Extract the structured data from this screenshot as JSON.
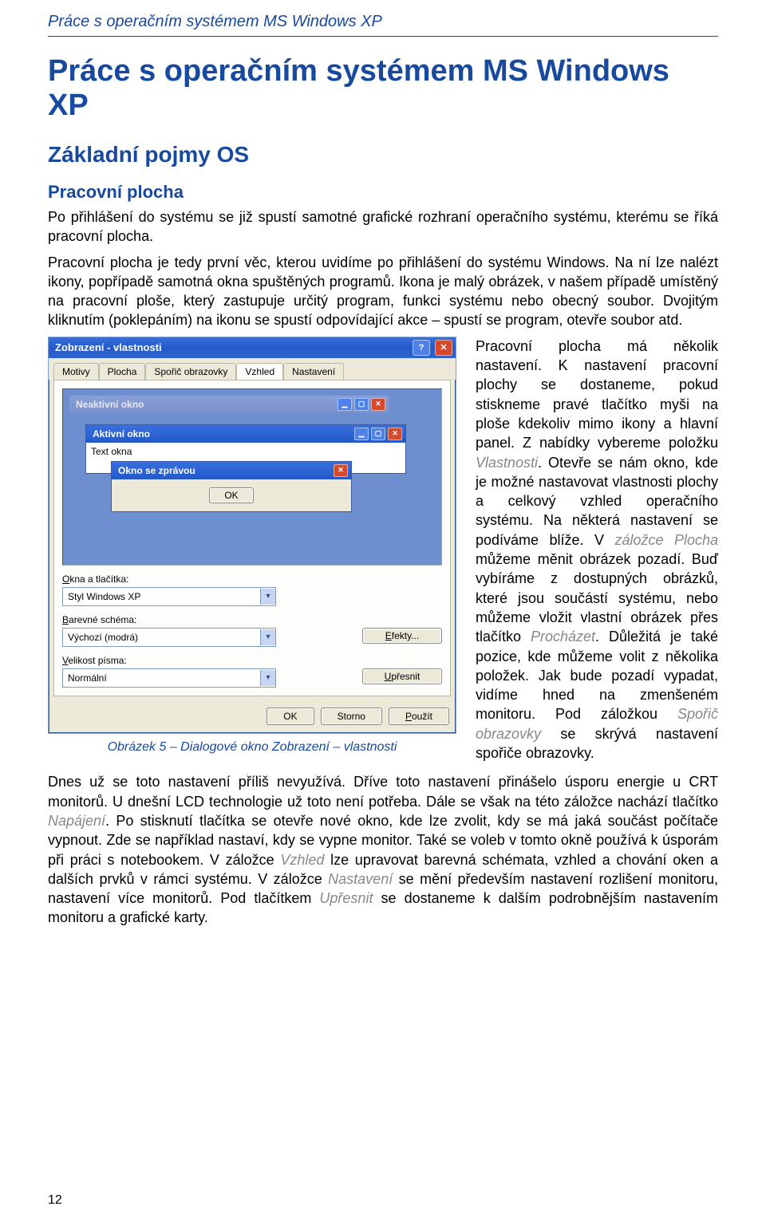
{
  "runningHead": "Práce s operačním systémem MS Windows XP",
  "headings": {
    "h1": "Práce s operačním systémem MS Windows XP",
    "h2": "Základní pojmy OS",
    "h3": "Pracovní plocha"
  },
  "paragraphs": {
    "p1": "Po přihlášení do systému se již spustí samotné grafické rozhraní operačního systému, kterému se říká pracovní plocha.",
    "p2": "Pracovní plocha je tedy první věc, kterou uvidíme po přihlášení do systému Windows. Na ní lze nalézt ikony, popřípadě samotná okna spuštěných programů. Ikona je malý obrázek, v našem případě umístěný na pracovní ploše, který zastupuje určitý program, funkci systému nebo obecný soubor. Dvojitým kliknutím (poklepáním) na ikonu se spustí odpovídající akce – spustí se program, otevře soubor atd.",
    "rightCol": {
      "a": "Pracovní plocha má několik nastavení. K nastavení pracovní plochy se dostaneme, pokud stiskneme pravé tlačítko myši na ploše kdekoliv mimo ikony a hlavní panel. Z nabídky vybereme položku ",
      "a_i": "Vlastnosti",
      "b": ". Otevře se nám okno, kde je možné nastavovat vlastnosti plochy a celkový vzhled operačního systému. Na některá nastavení se podíváme blíže. V ",
      "b_i": "záložce Plocha",
      "c": " můžeme měnit obrázek pozadí. Buď vybíráme z dostupných obrázků, které jsou součástí systému, nebo můžeme vložit vlastní obrázek přes tlačítko ",
      "c_i": "Procházet",
      "d": ". Důležitá je také pozice, kde můžeme volit z několika položek. Jak bude pozadí vypadat, vidíme hned na zmenšeném monitoru. Pod záložkou ",
      "d_i": "Spořič obrazovky",
      "e": " se skrývá nastavení spořiče obrazovky."
    },
    "bottom": {
      "a": "Dnes už se toto nastavení příliš nevyužívá. Dříve toto nastavení přinášelo úsporu energie u CRT monitorů. U dnešní LCD technologie už toto není potřeba. Dále se však na této záložce nachází tlačítko ",
      "a_i": "Napájení",
      "b": ". Po stisknutí tlačítka se otevře nové okno, kde lze zvolit, kdy se má jaká součást počítače vypnout. Zde se například nastaví, kdy se vypne monitor. Také se voleb v tomto okně používá k úsporám při práci s notebookem. V záložce ",
      "b_i": "Vzhled",
      "c": " lze upravovat barevná schémata, vzhled a chování oken a dalších prvků v rámci systému. V záložce ",
      "c_i": "Nastavení",
      "d": " se mění především nastavení rozlišení monitoru, nastavení více monitorů. Pod tlačítkem ",
      "d_i": "Upřesnit",
      "e": " se dostaneme k dalším podrobnějším nastavením monitoru a grafické karty."
    }
  },
  "figure": {
    "caption": "Obrázek 5 – Dialogové okno Zobrazení – vlastnosti",
    "dialog": {
      "title": "Zobrazení - vlastnosti",
      "tabs": [
        "Motivy",
        "Plocha",
        "Spořič obrazovky",
        "Vzhled",
        "Nastavení"
      ],
      "activeTabIndex": 3,
      "preview": {
        "inactiveTitle": "Neaktivní okno",
        "activeTitle": "Aktivní okno",
        "activeBodyText": "Text okna",
        "msgTitle": "Okno se zprávou",
        "msgButton": "OK"
      },
      "labels": {
        "windowsButtons": "Okna a tlačítka:",
        "windowsButtons_ul": "O",
        "colorScheme": "Barevné schéma:",
        "colorScheme_ul": "B",
        "fontSize": "Velikost písma:",
        "fontSize_ul": "V"
      },
      "values": {
        "windowsButtons": "Styl Windows XP",
        "colorScheme": "Výchozí (modrá)",
        "fontSize": "Normální"
      },
      "sideButtons": {
        "effects": "Efekty...",
        "effects_ul": "E",
        "advanced": "Upřesnit",
        "advanced_ul": "U"
      },
      "footer": {
        "ok": "OK",
        "cancel": "Storno",
        "apply": "Použít",
        "apply_ul": "P"
      }
    }
  },
  "pageNumber": "12"
}
